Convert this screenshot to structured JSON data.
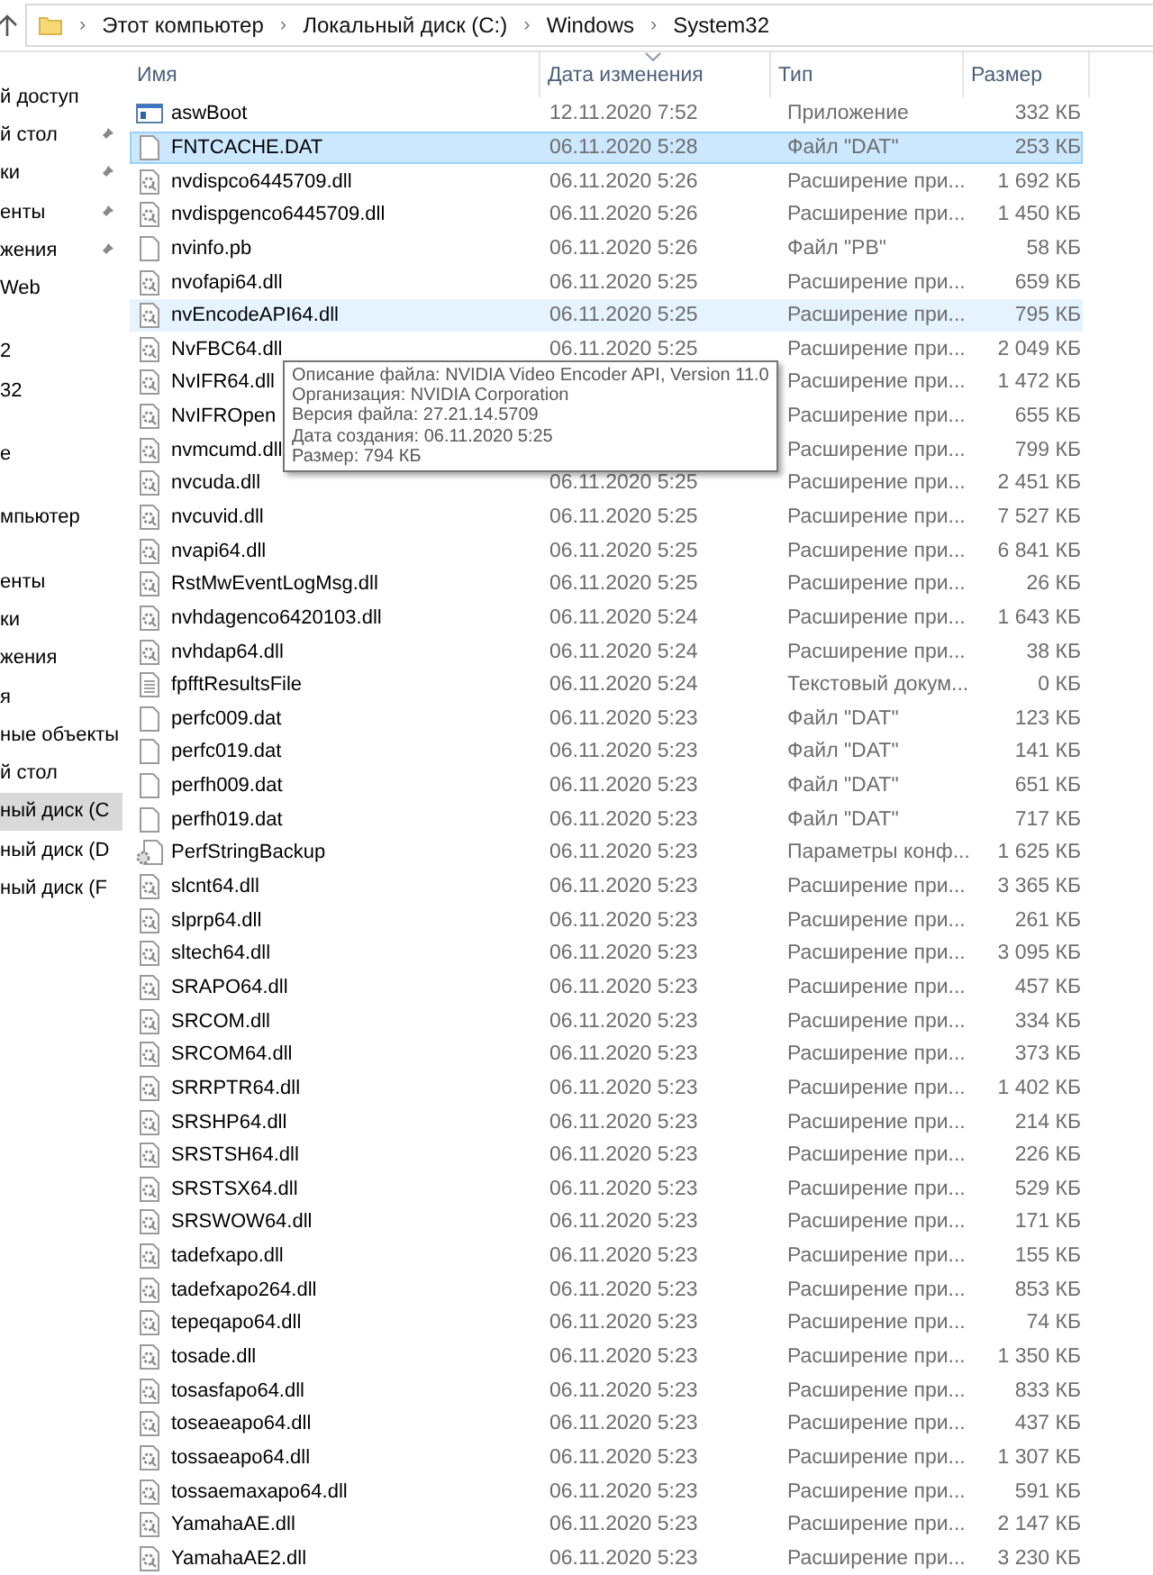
{
  "address_bar": {
    "path": [
      "Этот компьютер",
      "Локальный диск (C:)",
      "Windows",
      "System32"
    ],
    "separator": "›"
  },
  "sidebar": {
    "groups": [
      {
        "items": [
          {
            "label": "й доступ",
            "pinned": false,
            "selected": false
          },
          {
            "label": "й стол",
            "pinned": true,
            "selected": false
          },
          {
            "label": "ки",
            "pinned": true,
            "selected": false
          },
          {
            "label": "енты",
            "pinned": true,
            "selected": false
          },
          {
            "label": "жения",
            "pinned": true,
            "selected": false
          },
          {
            "label": "Web",
            "pinned": false,
            "selected": false
          }
        ]
      },
      {
        "items": [
          {
            "label": "2",
            "pinned": false,
            "selected": false
          },
          {
            "label": "32",
            "pinned": false,
            "selected": false
          }
        ]
      },
      {
        "items": [
          {
            "label": "е",
            "pinned": false,
            "selected": false
          }
        ]
      },
      {
        "items": [
          {
            "label": "мпьютер",
            "pinned": false,
            "selected": false
          }
        ]
      },
      {
        "items": [
          {
            "label": "енты",
            "pinned": false,
            "selected": false
          },
          {
            "label": "ки",
            "pinned": false,
            "selected": false
          },
          {
            "label": "жения",
            "pinned": false,
            "selected": false
          },
          {
            "label": "я",
            "pinned": false,
            "selected": false
          },
          {
            "label": "ные объекты",
            "pinned": false,
            "selected": false
          },
          {
            "label": "й стол",
            "pinned": false,
            "selected": false
          },
          {
            "label": "ный диск (С",
            "pinned": false,
            "selected": true
          },
          {
            "label": "ный диск (D",
            "pinned": false,
            "selected": false
          },
          {
            "label": "ный диск (F",
            "pinned": false,
            "selected": false
          }
        ]
      }
    ]
  },
  "table": {
    "columns": [
      {
        "label": "Имя",
        "sorted": false
      },
      {
        "label": "Дата изменения",
        "sorted": true
      },
      {
        "label": "Тип",
        "sorted": false
      },
      {
        "label": "Размер",
        "sorted": false
      }
    ],
    "rows": [
      {
        "kind": "app",
        "name": "aswBoot",
        "date": "12.11.2020 7:52",
        "type": "Приложение",
        "size": "332 КБ",
        "selected": false,
        "hovered": false
      },
      {
        "kind": "file",
        "name": "FNTCACHE.DAT",
        "date": "06.11.2020 5:28",
        "type": "Файл \"DAT\"",
        "size": "253 КБ",
        "selected": true,
        "hovered": false
      },
      {
        "kind": "dll",
        "name": "nvdispco6445709.dll",
        "date": "06.11.2020 5:26",
        "type": "Расширение при...",
        "size": "1 692 КБ",
        "selected": false,
        "hovered": false
      },
      {
        "kind": "dll",
        "name": "nvdispgenco6445709.dll",
        "date": "06.11.2020 5:26",
        "type": "Расширение при...",
        "size": "1 450 КБ",
        "selected": false,
        "hovered": false
      },
      {
        "kind": "file",
        "name": "nvinfo.pb",
        "date": "06.11.2020 5:26",
        "type": "Файл \"PB\"",
        "size": "58 КБ",
        "selected": false,
        "hovered": false
      },
      {
        "kind": "dll",
        "name": "nvofapi64.dll",
        "date": "06.11.2020 5:25",
        "type": "Расширение при...",
        "size": "659 КБ",
        "selected": false,
        "hovered": false
      },
      {
        "kind": "dll",
        "name": "nvEncodeAPI64.dll",
        "date": "06.11.2020 5:25",
        "type": "Расширение при...",
        "size": "795 КБ",
        "selected": false,
        "hovered": true
      },
      {
        "kind": "dll",
        "name": "NvFBC64.dll",
        "date": "06.11.2020 5:25",
        "type": "Расширение при...",
        "size": "2 049 КБ",
        "selected": false,
        "hovered": false
      },
      {
        "kind": "dll",
        "name": "NvIFR64.dll",
        "type": "Расширение при...",
        "size": "1 472 КБ",
        "selected": false,
        "hovered": false
      },
      {
        "kind": "dll",
        "name": "NvIFROpen",
        "type": "Расширение при...",
        "size": "655 КБ",
        "selected": false,
        "hovered": false
      },
      {
        "kind": "dll",
        "name": "nvmcumd.dll",
        "type": "Расширение при...",
        "size": "799 КБ",
        "selected": false,
        "hovered": false
      },
      {
        "kind": "dll",
        "name": "nvcuda.dll",
        "date": "06.11.2020 5:25",
        "type": "Расширение при...",
        "size": "2 451 КБ",
        "selected": false,
        "hovered": false
      },
      {
        "kind": "dll",
        "name": "nvcuvid.dll",
        "date": "06.11.2020 5:25",
        "type": "Расширение при...",
        "size": "7 527 КБ",
        "selected": false,
        "hovered": false
      },
      {
        "kind": "dll",
        "name": "nvapi64.dll",
        "date": "06.11.2020 5:25",
        "type": "Расширение при...",
        "size": "6 841 КБ",
        "selected": false,
        "hovered": false
      },
      {
        "kind": "dll",
        "name": "RstMwEventLogMsg.dll",
        "date": "06.11.2020 5:25",
        "type": "Расширение при...",
        "size": "26 КБ",
        "selected": false,
        "hovered": false
      },
      {
        "kind": "dll",
        "name": "nvhdagenco6420103.dll",
        "date": "06.11.2020 5:24",
        "type": "Расширение при...",
        "size": "1 643 КБ",
        "selected": false,
        "hovered": false
      },
      {
        "kind": "dll",
        "name": "nvhdap64.dll",
        "date": "06.11.2020 5:24",
        "type": "Расширение при...",
        "size": "38 КБ",
        "selected": false,
        "hovered": false
      },
      {
        "kind": "text",
        "name": "fpfftResultsFile",
        "date": "06.11.2020 5:24",
        "type": "Текстовый докум...",
        "size": "0 КБ",
        "selected": false,
        "hovered": false
      },
      {
        "kind": "file",
        "name": "perfc009.dat",
        "date": "06.11.2020 5:23",
        "type": "Файл \"DAT\"",
        "size": "123 КБ",
        "selected": false,
        "hovered": false
      },
      {
        "kind": "file",
        "name": "perfc019.dat",
        "date": "06.11.2020 5:23",
        "type": "Файл \"DAT\"",
        "size": "141 КБ",
        "selected": false,
        "hovered": false
      },
      {
        "kind": "file",
        "name": "perfh009.dat",
        "date": "06.11.2020 5:23",
        "type": "Файл \"DAT\"",
        "size": "651 КБ",
        "selected": false,
        "hovered": false
      },
      {
        "kind": "file",
        "name": "perfh019.dat",
        "date": "06.11.2020 5:23",
        "type": "Файл \"DAT\"",
        "size": "717 КБ",
        "selected": false,
        "hovered": false
      },
      {
        "kind": "config",
        "name": "PerfStringBackup",
        "date": "06.11.2020 5:23",
        "type": "Параметры конф...",
        "size": "1 625 КБ",
        "selected": false,
        "hovered": false
      },
      {
        "kind": "dll",
        "name": "slcnt64.dll",
        "date": "06.11.2020 5:23",
        "type": "Расширение при...",
        "size": "3 365 КБ",
        "selected": false,
        "hovered": false
      },
      {
        "kind": "dll",
        "name": "slprp64.dll",
        "date": "06.11.2020 5:23",
        "type": "Расширение при...",
        "size": "261 КБ",
        "selected": false,
        "hovered": false
      },
      {
        "kind": "dll",
        "name": "sltech64.dll",
        "date": "06.11.2020 5:23",
        "type": "Расширение при...",
        "size": "3 095 КБ",
        "selected": false,
        "hovered": false
      },
      {
        "kind": "dll",
        "name": "SRAPO64.dll",
        "date": "06.11.2020 5:23",
        "type": "Расширение при...",
        "size": "457 КБ",
        "selected": false,
        "hovered": false
      },
      {
        "kind": "dll",
        "name": "SRCOM.dll",
        "date": "06.11.2020 5:23",
        "type": "Расширение при...",
        "size": "334 КБ",
        "selected": false,
        "hovered": false
      },
      {
        "kind": "dll",
        "name": "SRCOM64.dll",
        "date": "06.11.2020 5:23",
        "type": "Расширение при...",
        "size": "373 КБ",
        "selected": false,
        "hovered": false
      },
      {
        "kind": "dll",
        "name": "SRRPTR64.dll",
        "date": "06.11.2020 5:23",
        "type": "Расширение при...",
        "size": "1 402 КБ",
        "selected": false,
        "hovered": false
      },
      {
        "kind": "dll",
        "name": "SRSHP64.dll",
        "date": "06.11.2020 5:23",
        "type": "Расширение при...",
        "size": "214 КБ",
        "selected": false,
        "hovered": false
      },
      {
        "kind": "dll",
        "name": "SRSTSH64.dll",
        "date": "06.11.2020 5:23",
        "type": "Расширение при...",
        "size": "226 КБ",
        "selected": false,
        "hovered": false
      },
      {
        "kind": "dll",
        "name": "SRSTSX64.dll",
        "date": "06.11.2020 5:23",
        "type": "Расширение при...",
        "size": "529 КБ",
        "selected": false,
        "hovered": false
      },
      {
        "kind": "dll",
        "name": "SRSWOW64.dll",
        "date": "06.11.2020 5:23",
        "type": "Расширение при...",
        "size": "171 КБ",
        "selected": false,
        "hovered": false
      },
      {
        "kind": "dll",
        "name": "tadefxapo.dll",
        "date": "06.11.2020 5:23",
        "type": "Расширение при...",
        "size": "155 КБ",
        "selected": false,
        "hovered": false
      },
      {
        "kind": "dll",
        "name": "tadefxapo264.dll",
        "date": "06.11.2020 5:23",
        "type": "Расширение при...",
        "size": "853 КБ",
        "selected": false,
        "hovered": false
      },
      {
        "kind": "dll",
        "name": "tepeqapo64.dll",
        "date": "06.11.2020 5:23",
        "type": "Расширение при...",
        "size": "74 КБ",
        "selected": false,
        "hovered": false
      },
      {
        "kind": "dll",
        "name": "tosade.dll",
        "date": "06.11.2020 5:23",
        "type": "Расширение при...",
        "size": "1 350 КБ",
        "selected": false,
        "hovered": false
      },
      {
        "kind": "dll",
        "name": "tosasfapo64.dll",
        "date": "06.11.2020 5:23",
        "type": "Расширение при...",
        "size": "833 КБ",
        "selected": false,
        "hovered": false
      },
      {
        "kind": "dll",
        "name": "toseaeapo64.dll",
        "date": "06.11.2020 5:23",
        "type": "Расширение при...",
        "size": "437 КБ",
        "selected": false,
        "hovered": false
      },
      {
        "kind": "dll",
        "name": "tossaeapo64.dll",
        "date": "06.11.2020 5:23",
        "type": "Расширение при...",
        "size": "1 307 КБ",
        "selected": false,
        "hovered": false
      },
      {
        "kind": "dll",
        "name": "tossaemaxapo64.dll",
        "date": "06.11.2020 5:23",
        "type": "Расширение при...",
        "size": "591 КБ",
        "selected": false,
        "hovered": false
      },
      {
        "kind": "dll",
        "name": "YamahaAE.dll",
        "date": "06.11.2020 5:23",
        "type": "Расширение при...",
        "size": "2 147 КБ",
        "selected": false,
        "hovered": false
      },
      {
        "kind": "dll",
        "name": "YamahaAE2.dll",
        "date": "06.11.2020 5:23",
        "type": "Расширение при...",
        "size": "3 230 КБ",
        "selected": false,
        "hovered": false
      }
    ]
  },
  "tooltip": {
    "lines": [
      "Описание файла: NVIDIA Video Encoder API, Version 11.0",
      "Организация: NVIDIA Corporation",
      "Версия файла: 27.21.14.5709",
      "Дата создания: 06.11.2020 5:25",
      "Размер: 794 КБ"
    ]
  }
}
